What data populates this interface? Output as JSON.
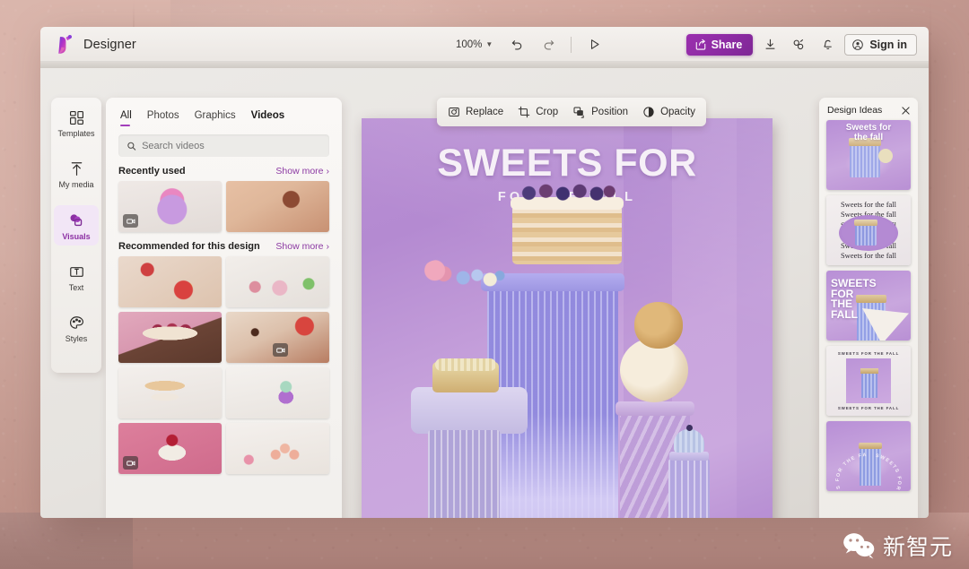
{
  "window": {
    "app_title": "Designer",
    "logo_icon": "designer-logo-icon"
  },
  "toolbar": {
    "zoom_level": "100%",
    "zoom_chevron_icon": "chevron-down-icon",
    "undo_icon": "undo-arrow-icon",
    "redo_icon": "redo-arrow-icon",
    "present_icon": "play-triangle-icon",
    "share_label": "Share",
    "share_icon": "share-arrow-icon",
    "share_color": "#8d2ba3",
    "download_icon": "download-icon",
    "link_icon": "chain-link-icon",
    "notification_icon": "bell-icon",
    "signin_label": "Sign in",
    "signin_icon": "account-circle-icon"
  },
  "sidebar": {
    "items": [
      {
        "label": "Templates",
        "icon": "grid-squares-icon",
        "active": false
      },
      {
        "label": "My media",
        "icon": "upload-arrow-icon",
        "active": false
      },
      {
        "label": "Visuals",
        "icon": "shapes-overlap-icon",
        "active": true
      },
      {
        "label": "Text",
        "icon": "text-box-icon",
        "active": false
      },
      {
        "label": "Styles",
        "icon": "palette-icon",
        "active": false
      }
    ],
    "active_color": "#8b2fa3"
  },
  "media_panel": {
    "tabs": [
      {
        "label": "All",
        "active": true
      },
      {
        "label": "Photos",
        "active": false
      },
      {
        "label": "Graphics",
        "active": false
      },
      {
        "label": "Videos",
        "active": false,
        "bold": true
      }
    ],
    "tab_underline_color": "#a23fbb",
    "search": {
      "icon": "search-icon",
      "placeholder": "Search videos",
      "value": ""
    },
    "sections": [
      {
        "title": "Recently used",
        "show_more": "Show more",
        "show_more_icon": "chevron-right-icon",
        "items": [
          {
            "name": "pink-purple-tiered-cake",
            "art": "t1",
            "video": true
          },
          {
            "name": "kitchen-counter-lemon-bowl",
            "art": "t2",
            "video": false
          }
        ]
      },
      {
        "title": "Recommended for this design",
        "show_more": "Show more",
        "show_more_icon": "chevron-right-icon",
        "items": [
          {
            "name": "lemon-slices-red-plate",
            "art": "t3",
            "video": false
          },
          {
            "name": "pastel-desserts-trio",
            "art": "t4",
            "video": false
          },
          {
            "name": "raspberry-chocolate-cake",
            "art": "t5",
            "video": false
          },
          {
            "name": "strawberries-coffee-mug",
            "art": "t6",
            "video": true
          },
          {
            "name": "white-layer-cake-stand",
            "art": "t7",
            "video": false
          },
          {
            "name": "purple-frosted-cupcake",
            "art": "t8",
            "video": false
          },
          {
            "name": "cherry-pudding-pink",
            "art": "t9",
            "video": true
          },
          {
            "name": "macaron-tower",
            "art": "t10",
            "video": false
          }
        ]
      }
    ]
  },
  "context_toolbar": {
    "items": [
      {
        "label": "Replace",
        "icon": "image-replace-icon"
      },
      {
        "label": "Crop",
        "icon": "crop-icon"
      },
      {
        "label": "Position",
        "icon": "position-layers-icon"
      },
      {
        "label": "Opacity",
        "icon": "opacity-half-circle-icon"
      }
    ]
  },
  "canvas": {
    "headline": "SWEETS FOR",
    "subheadline": "FOR THE FALL",
    "background_color": "#b98fd4",
    "text_color": "#f6f0f7",
    "scene_description": "Purple pedestal still-life with berry layer cake, tart, bread rolls and mini cupcake"
  },
  "design_ideas": {
    "title": "Design Ideas",
    "close_icon": "close-x-icon",
    "thumbnails": [
      {
        "name": "idea-sweets-for-the-fall-top",
        "caption": "Sweets for\nthe fall",
        "style": "script-top"
      },
      {
        "name": "idea-repeated-serif-text",
        "caption": "Sweets for the fall",
        "style": "repeat-serif"
      },
      {
        "name": "idea-bold-block-title",
        "caption": "SWEETS\nFOR\nTHE\nFALL",
        "style": "bold-block"
      },
      {
        "name": "idea-framed-caption",
        "caption": "SWEETS FOR THE FALL",
        "style": "framed"
      },
      {
        "name": "idea-circular-text",
        "caption": "SWEETS FOR THE FALL",
        "style": "circular"
      }
    ]
  },
  "watermark": {
    "icon": "wechat-icon",
    "text": "新智元"
  }
}
